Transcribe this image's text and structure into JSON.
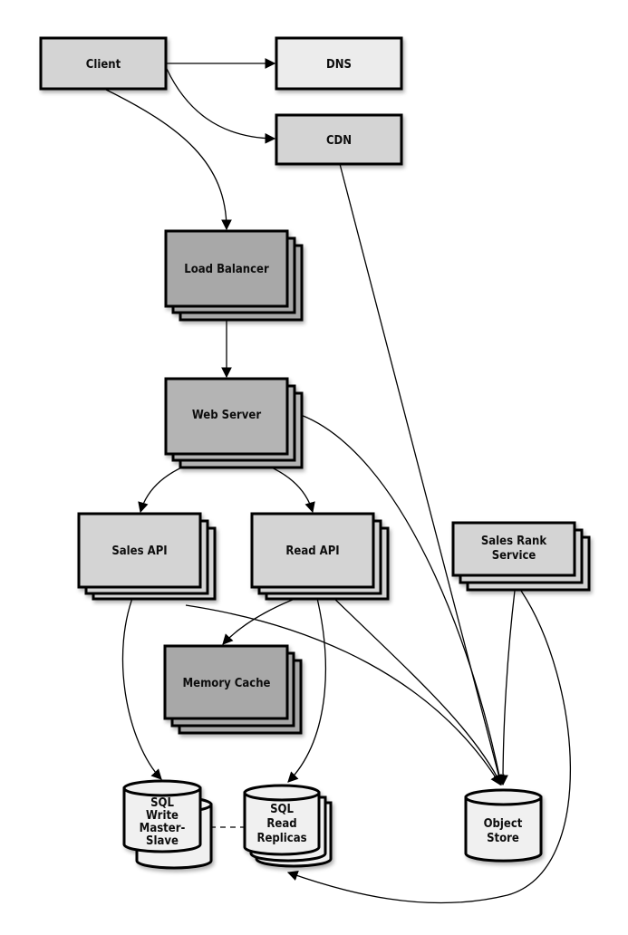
{
  "nodes": {
    "client": {
      "label": "Client",
      "fill": "#d4d4d4"
    },
    "dns": {
      "label": "DNS",
      "fill": "#ececec"
    },
    "cdn": {
      "label": "CDN",
      "fill": "#d4d4d4"
    },
    "load_balancer": {
      "label": "Load Balancer",
      "fill": "#a8a8a8"
    },
    "web_server": {
      "label": "Web Server",
      "fill": "#b4b4b4"
    },
    "sales_api": {
      "label": "Sales API",
      "fill": "#d4d4d4"
    },
    "read_api": {
      "label": "Read API",
      "fill": "#d4d4d4"
    },
    "sales_rank": {
      "label_lines": [
        "Sales Rank",
        "Service"
      ],
      "fill": "#d4d4d4"
    },
    "memory_cache": {
      "label": "Memory Cache",
      "fill": "#a8a8a8"
    },
    "sql_write": {
      "label_lines": [
        "SQL",
        "Write",
        "Master-",
        "Slave"
      ],
      "fill": "#f0f0f0"
    },
    "sql_read": {
      "label_lines": [
        "SQL",
        "Read",
        "Replicas"
      ],
      "fill": "#f0f0f0"
    },
    "object_store": {
      "label_lines": [
        "Object",
        "Store"
      ],
      "fill": "#f0f0f0"
    }
  },
  "edges": [
    {
      "from": "Client",
      "to": "DNS"
    },
    {
      "from": "Client",
      "to": "CDN"
    },
    {
      "from": "Client",
      "to": "Load Balancer"
    },
    {
      "from": "Load Balancer",
      "to": "Web Server"
    },
    {
      "from": "Web Server",
      "to": "Sales API"
    },
    {
      "from": "Web Server",
      "to": "Read API"
    },
    {
      "from": "Web Server",
      "to": "Object Store"
    },
    {
      "from": "CDN",
      "to": "Object Store"
    },
    {
      "from": "Sales API",
      "to": "SQL Write Master-Slave"
    },
    {
      "from": "Sales API",
      "to": "Object Store"
    },
    {
      "from": "Read API",
      "to": "Memory Cache"
    },
    {
      "from": "Read API",
      "to": "SQL Read Replicas"
    },
    {
      "from": "Read API",
      "to": "Object Store"
    },
    {
      "from": "Sales Rank Service",
      "to": "Object Store"
    },
    {
      "from": "Sales Rank Service",
      "to": "SQL Read Replicas"
    },
    {
      "from": "SQL Write Master-Slave",
      "to": "SQL Read Replicas",
      "style": "dashed"
    }
  ]
}
